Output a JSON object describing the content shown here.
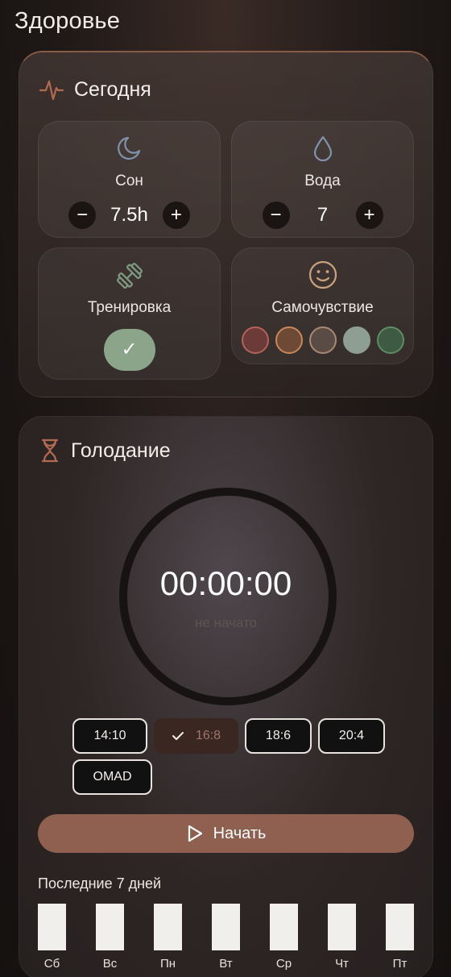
{
  "page": {
    "title": "Здоровье"
  },
  "today": {
    "title": "Сегодня",
    "sleep": {
      "label": "Сон",
      "value": "7.5h",
      "minus": "−",
      "plus": "+"
    },
    "water": {
      "label": "Вода",
      "value": "7",
      "minus": "−",
      "plus": "+"
    },
    "workout": {
      "label": "Тренировка",
      "check": "✓",
      "done": true
    },
    "mood": {
      "label": "Самочувствие",
      "options": [
        {
          "fill": "#6b3b3a",
          "ring": "#b5625a"
        },
        {
          "fill": "#6e4a36",
          "ring": "#c9875c"
        },
        {
          "fill": "#5a4c44",
          "ring": "#a88a72"
        },
        {
          "fill": "#8e9e92",
          "ring": "#8e9e92"
        },
        {
          "fill": "#3f5a42",
          "ring": "#5f8c62"
        }
      ]
    }
  },
  "fasting": {
    "title": "Голодание",
    "timer": "00:00:00",
    "status": "не начато",
    "plans": [
      "14:10",
      "16:8",
      "18:6",
      "20:4",
      "OMAD"
    ],
    "selected_plan": "16:8",
    "start_label": "Начать",
    "last7_title": "Последние 7 дней",
    "days": [
      "Сб",
      "Вс",
      "Пн",
      "Вт",
      "Ср",
      "Чт",
      "Пт"
    ]
  },
  "colors": {
    "accent": "#8f5f4f",
    "success": "#8aa58a",
    "icon_blue": "#7f93ad",
    "icon_green": "#7e9a80",
    "icon_tan": "#c9a27e",
    "icon_terracotta": "#b36a52"
  }
}
